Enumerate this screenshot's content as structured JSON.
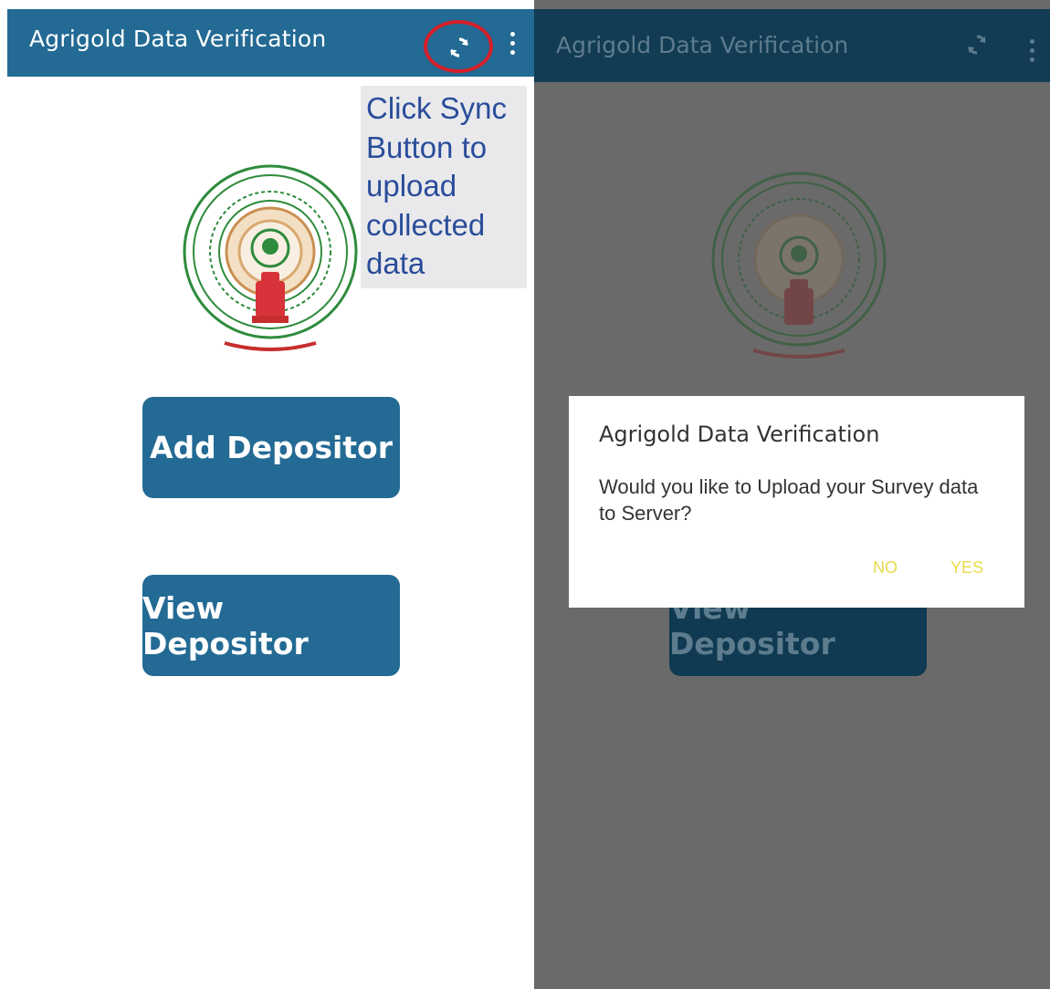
{
  "left_screen": {
    "appbar": {
      "title": "Agrigold Data Verification",
      "sync_icon": "sync-icon",
      "menu_icon": "overflow-menu-icon"
    },
    "tooltip": {
      "text": "Click Sync Button to upload collected data"
    },
    "emblem_icon": "andhra-pradesh-emblem",
    "buttons": {
      "add": "Add Depositor",
      "view": "View Depositor"
    }
  },
  "right_screen": {
    "appbar": {
      "title": "Agrigold Data Verification"
    },
    "buttons": {
      "view": "View Depositor"
    },
    "dialog": {
      "title": "Agrigold Data Verification",
      "message": "Would you like to Upload your Survey data to Server?",
      "no_label": "NO",
      "yes_label": "YES"
    }
  },
  "colors": {
    "primary": "#236a94",
    "highlight_circle": "#d3202a",
    "tooltip_text": "#2a4d9a",
    "dialog_buttons": "#e8dc4a",
    "overlay": "#6a6a6a"
  }
}
